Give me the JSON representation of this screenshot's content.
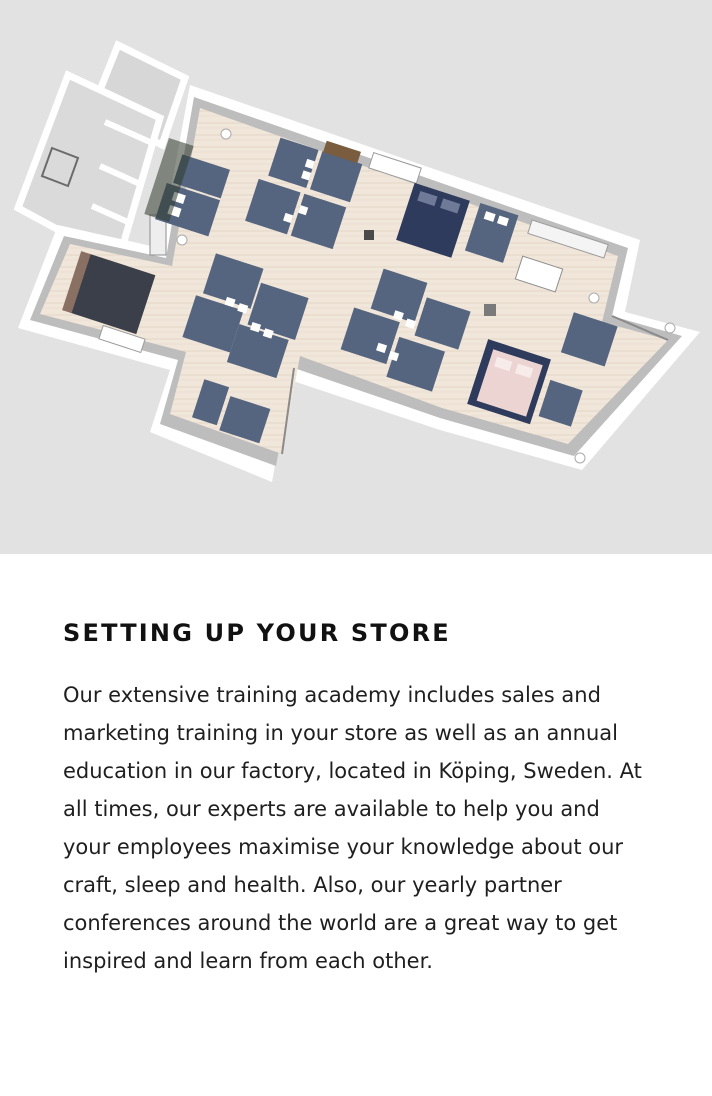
{
  "hero": {
    "image_alt": "Floor plan of a bed store showroom",
    "background": "#e2e2e3",
    "bed_color": "#55647f",
    "floor_color": "#f0e4d8"
  },
  "section": {
    "title": "SETTING UP YOUR STORE",
    "body": "Our extensive training academy includes sales and marketing training in your store as well as an annual education in our factory, located in Köping, Sweden. At all times, our experts are available to help you and your employees maximise your knowledge about our craft, sleep and health. Also, our yearly partner conferences around the world are a great way to get inspired and learn from each other."
  }
}
